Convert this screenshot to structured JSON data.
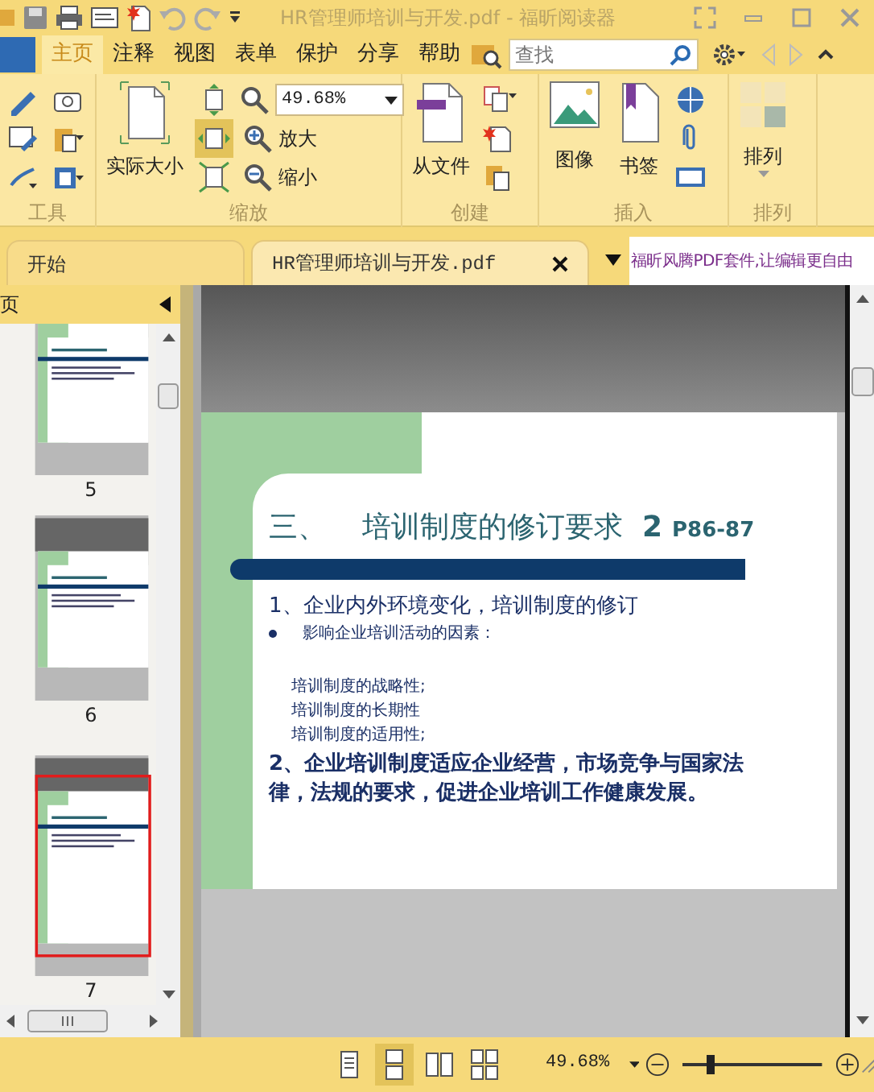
{
  "title_bar": {
    "title": "HR管理师培训与开发.pdf - 福昕阅读器"
  },
  "menu_tabs": [
    {
      "label": "主页",
      "selected": true
    },
    {
      "label": "注释",
      "selected": false
    },
    {
      "label": "视图",
      "selected": false
    },
    {
      "label": "表单",
      "selected": false
    },
    {
      "label": "保护",
      "selected": false
    },
    {
      "label": "分享",
      "selected": false
    },
    {
      "label": "帮助",
      "selected": false
    }
  ],
  "search": {
    "placeholder": "查找"
  },
  "ribbon": {
    "groups": [
      {
        "kind": "tools",
        "label": "工具"
      },
      {
        "kind": "zoom",
        "label": "缩放",
        "large_button": "实际大小",
        "zoom_value": "49.68%",
        "zoom_in": "放大",
        "zoom_out": "缩小",
        "fit_modes": [
          {
            "selected": false
          },
          {
            "selected": true
          },
          {
            "selected": false
          }
        ]
      },
      {
        "kind": "create",
        "label": "创建",
        "large_buttons": [
          "从文件"
        ]
      },
      {
        "kind": "insert",
        "label": "插入",
        "large_buttons": [
          "图像",
          "书签"
        ]
      },
      {
        "kind": "arrange",
        "label": "排列",
        "large_buttons": [
          "排列"
        ]
      }
    ]
  },
  "document_tabs": [
    {
      "label": "开始",
      "selected": false,
      "closable": false
    },
    {
      "label": "HR管理师培训与开发.pdf",
      "selected": true,
      "closable": true
    }
  ],
  "ad_banner": "福昕风腾PDF套件,让编辑更自由",
  "pages_panel": {
    "title": "页",
    "thumbnails": [
      {
        "page": "5",
        "selected": false
      },
      {
        "page": "6",
        "selected": false
      },
      {
        "page": "7",
        "selected": true
      }
    ]
  },
  "slide": {
    "title_number": "三、",
    "title": "培训制度的修订要求",
    "title_suffix": "2",
    "page_ref": "P86-87",
    "lines": [
      {
        "kind": "numbered",
        "text": "1、企业内外环境变化，培训制度的修订"
      },
      {
        "kind": "bullet",
        "text": "影响企业培训活动的因素："
      },
      {
        "kind": "sub",
        "text": "培训制度的战略性;"
      },
      {
        "kind": "sub",
        "text": "培训制度的长期性"
      },
      {
        "kind": "sub",
        "text": "培训制度的适用性;"
      },
      {
        "kind": "numbered",
        "text": "2、企业培训制度适应企业经营，市场竞争与国家法律，法规的要求，促进企业培训工作健康发展。"
      }
    ]
  },
  "status_bar": {
    "view_modes": [
      {
        "selected": false
      },
      {
        "selected": true
      },
      {
        "selected": false
      },
      {
        "selected": false
      }
    ],
    "zoom": "49.68%",
    "zoom_slider": {
      "level": 0.2
    }
  }
}
